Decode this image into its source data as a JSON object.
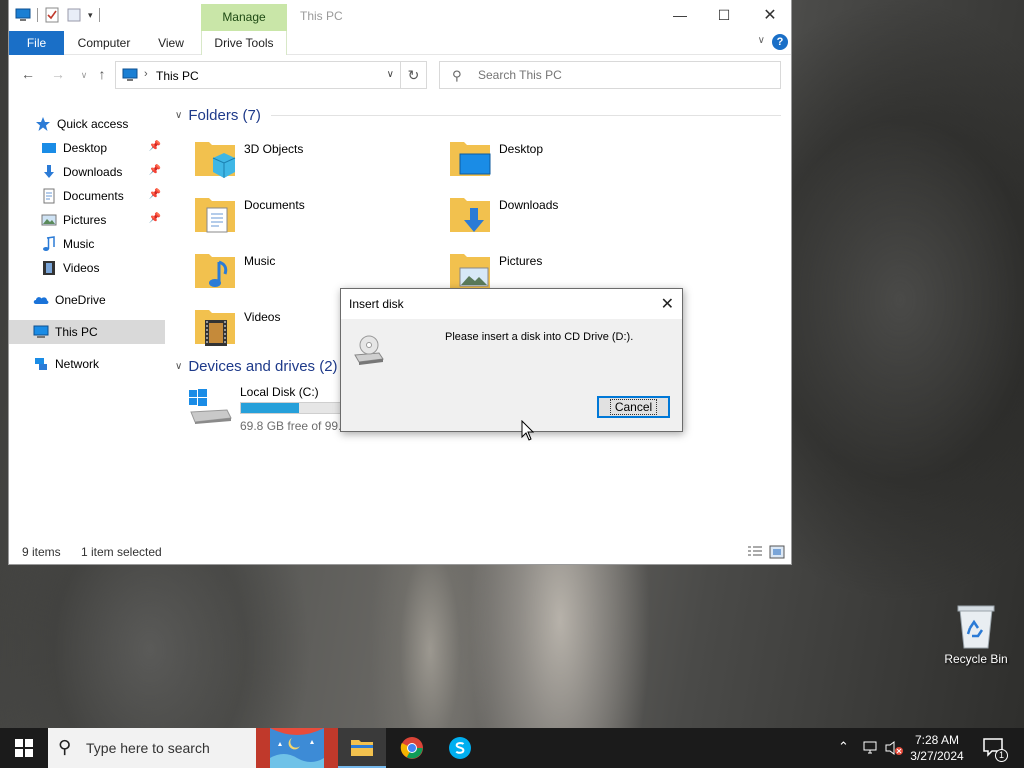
{
  "explorer": {
    "title": "This PC",
    "manage_tab": "Manage",
    "ribbon_tabs": {
      "file": "File",
      "computer": "Computer",
      "view": "View",
      "drive_tools": "Drive Tools"
    },
    "help": "?",
    "address_crumb": "This PC",
    "search_placeholder": "Search This PC",
    "sidebar": {
      "quick_access": "Quick access",
      "desktop": "Desktop",
      "downloads": "Downloads",
      "documents": "Documents",
      "pictures": "Pictures",
      "music": "Music",
      "videos": "Videos",
      "onedrive": "OneDrive",
      "this_pc": "This PC",
      "network": "Network"
    },
    "folders_header": "Folders (7)",
    "folders": {
      "objects3d": "3D Objects",
      "desktop": "Desktop",
      "documents": "Documents",
      "downloads": "Downloads",
      "music": "Music",
      "pictures": "Pictures",
      "videos": "Videos"
    },
    "devices_header": "Devices and drives (2)",
    "drive": {
      "name": "Local Disk (C:)",
      "free": "69.8 GB free of 99.3",
      "used_fraction": 0.297
    },
    "status": {
      "items": "9 items",
      "selected": "1 item selected"
    }
  },
  "dialog": {
    "title": "Insert disk",
    "message": "Please insert a disk into CD Drive (D:).",
    "cancel": "Cancel"
  },
  "desktop": {
    "recycle_bin": "Recycle Bin"
  },
  "taskbar": {
    "search_placeholder": "Type here to search",
    "time": "7:28 AM",
    "date": "3/27/2024",
    "notifications": "1"
  },
  "colors": {
    "accent": "#0078d7",
    "file_tab": "#1a6fc7",
    "manage_tab": "#c9e6a8",
    "drive_bar": "#26a0da",
    "folder": "#f2c14e"
  }
}
